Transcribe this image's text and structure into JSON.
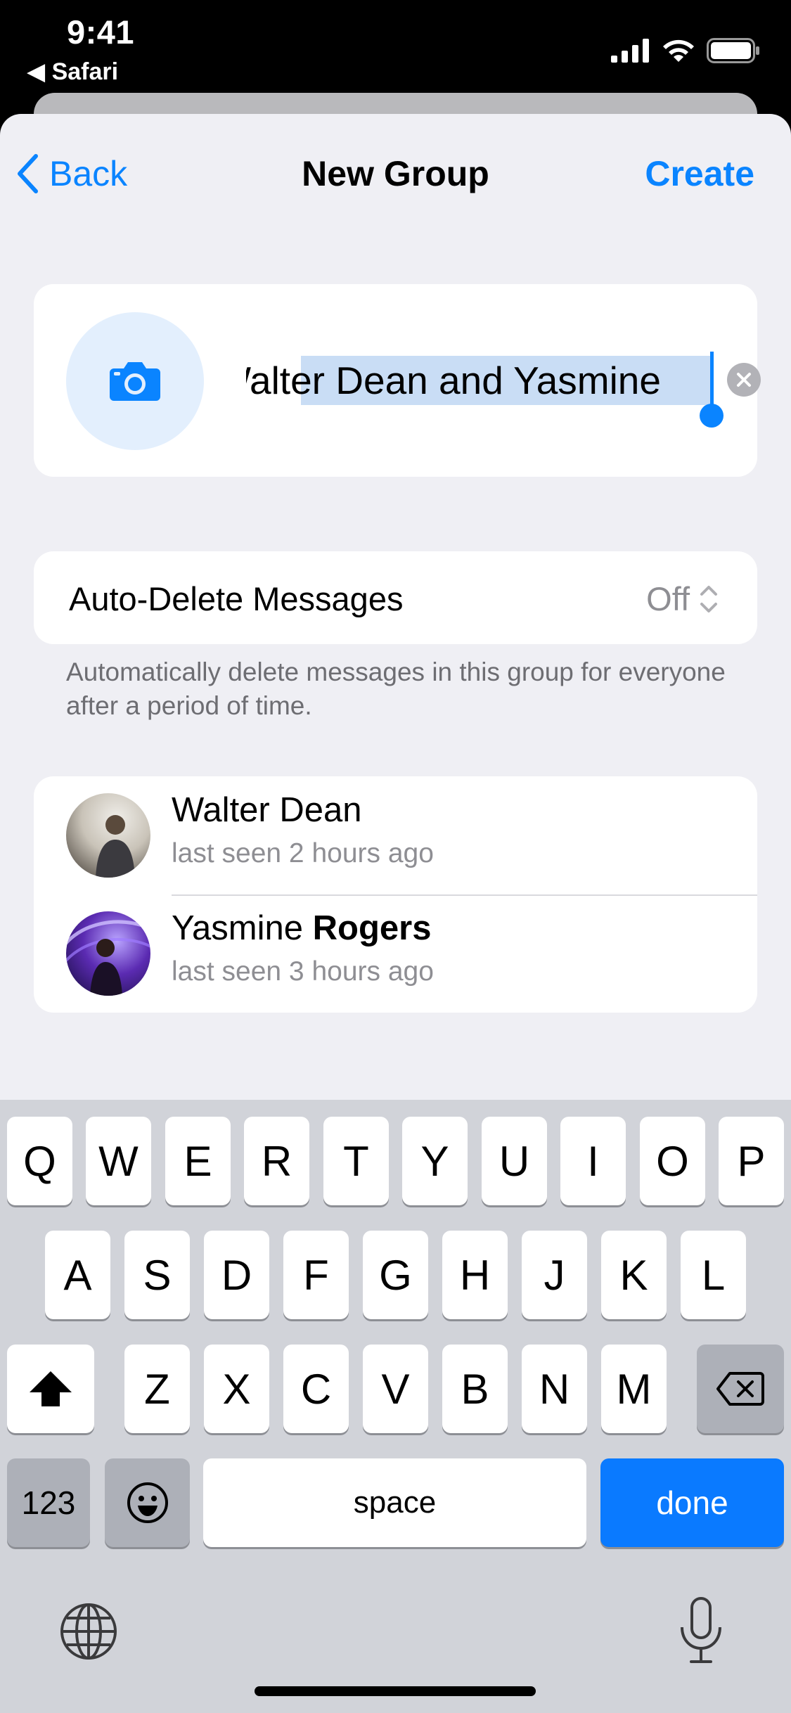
{
  "status_bar": {
    "time": "9:41",
    "back_app": "◀ Safari"
  },
  "nav": {
    "back_label": "Back",
    "title": "New Group",
    "create_label": "Create"
  },
  "group": {
    "name_value": "Walter Dean and Yasmine"
  },
  "auto_delete": {
    "label": "Auto-Delete Messages",
    "value": "Off",
    "footnote": "Automatically delete messages in this group for everyone after a period of time."
  },
  "members": [
    {
      "name_first": "Walter",
      "name_last": "Dean",
      "status": "last seen 2 hours ago"
    },
    {
      "name_first": "Yasmine",
      "name_last": "Rogers",
      "status": "last seen 3 hours ago"
    }
  ],
  "keyboard": {
    "row1": [
      "Q",
      "W",
      "E",
      "R",
      "T",
      "Y",
      "U",
      "I",
      "O",
      "P"
    ],
    "row2": [
      "A",
      "S",
      "D",
      "F",
      "G",
      "H",
      "J",
      "K",
      "L"
    ],
    "row3": [
      "Z",
      "X",
      "C",
      "V",
      "B",
      "N",
      "M"
    ],
    "numbers_label": "123",
    "space_label": "space",
    "done_label": "done"
  },
  "colors": {
    "accent": "#0a84ff",
    "background": "#efeff4",
    "secondary_text": "#8e8e93"
  },
  "icons": [
    "back-chevron-icon",
    "camera-icon",
    "clear-icon",
    "updown-chevron-icon",
    "shift-icon",
    "delete-icon",
    "emoji-icon",
    "globe-icon",
    "microphone-icon",
    "signal-icon",
    "wifi-icon",
    "battery-icon"
  ]
}
